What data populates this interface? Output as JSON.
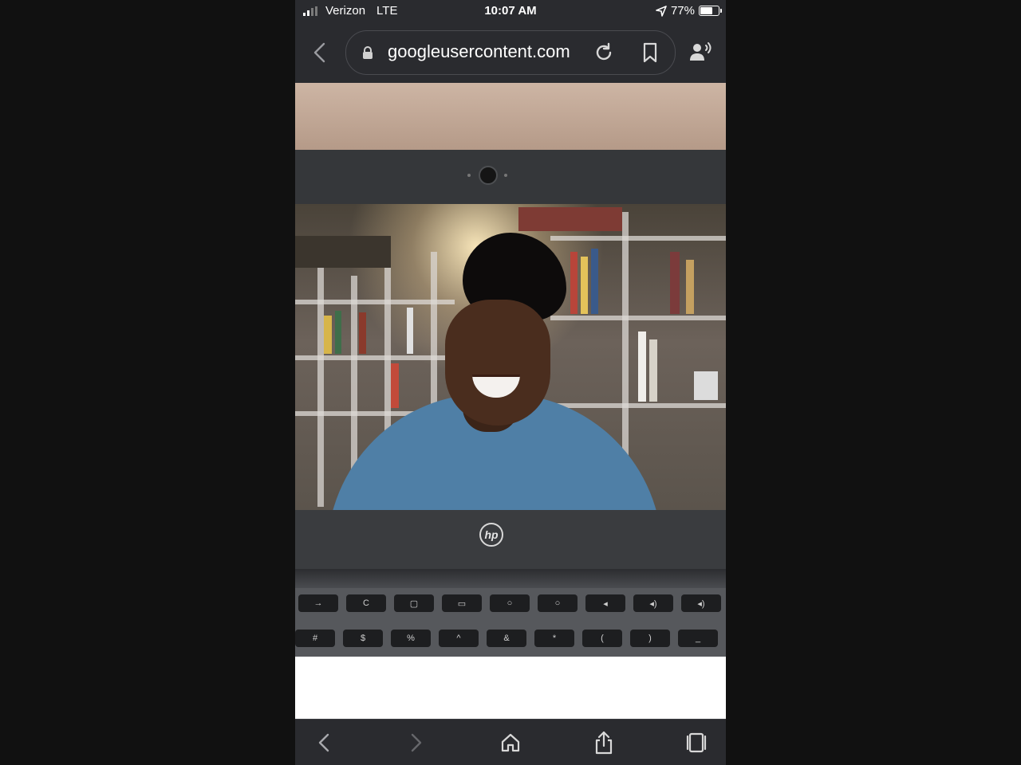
{
  "status_bar": {
    "carrier": "Verizon",
    "network": "LTE",
    "time": "10:07 AM",
    "battery_percent": "77%",
    "battery_level": 0.77,
    "signal_bars": 2,
    "location_icon": "location-arrow-icon"
  },
  "url_bar": {
    "url": "googleusercontent.com",
    "icons": [
      "back-chevron-icon",
      "lock-icon",
      "reload-icon",
      "bookmark-icon",
      "listen-icon"
    ]
  },
  "photo": {
    "laptop_brand": "hp"
  },
  "keyboard": {
    "row1": [
      "→",
      "C",
      "▢",
      "▭",
      "○",
      "○",
      "◂",
      "◂)",
      "◂)"
    ],
    "row2": [
      "#",
      "$",
      "%",
      "^",
      "&",
      "*",
      "(",
      ")",
      "_"
    ]
  },
  "bottom_toolbar": {
    "icons": [
      "back-icon",
      "forward-icon",
      "home-icon",
      "share-icon",
      "tabs-icon"
    ]
  }
}
